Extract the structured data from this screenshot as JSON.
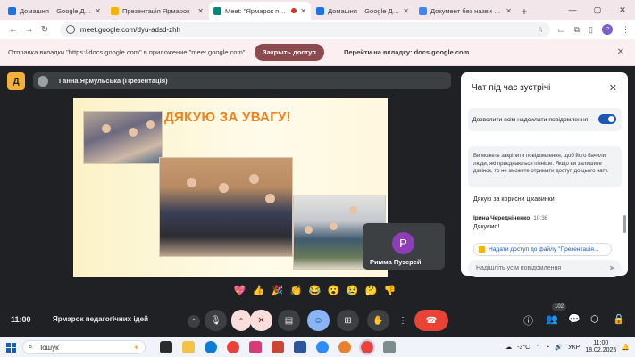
{
  "tabs": [
    {
      "title": "Домашня – Google Диск",
      "favicon_color": "#1a73e8",
      "active": false
    },
    {
      "title": "Презентація Ярмарок",
      "favicon_color": "#f4b400",
      "active": false
    },
    {
      "title": "Meet: \"Ярмарок педаго",
      "favicon_color": "#00897b",
      "active": true
    },
    {
      "title": "Домашня – Google Диск",
      "favicon_color": "#1a73e8",
      "active": false
    },
    {
      "title": "Документ без назви - Goo",
      "favicon_color": "#4285f4",
      "active": false
    }
  ],
  "tabstrip": {
    "new_tab": "+",
    "close": "✕"
  },
  "window": {
    "minimize": "—",
    "maximize": "▢",
    "close": "✕"
  },
  "address": {
    "url": "meet.google.com/dyu-adsd-zhh"
  },
  "infobar": {
    "message": "Отправка вкладки \"https://docs.google.com\" в приложение \"meet.google.com\"...",
    "share_button": "Закрыть доступ",
    "goto_link": "Перейти на вкладку: docs.google.com",
    "close": "✕"
  },
  "meet": {
    "logo_letter": "Д",
    "presenter": "Ганна Ярмульська (Презентація)",
    "slide_title": "ДЯКУЮ ЗА УВАГУ!",
    "participant": {
      "initial": "P",
      "name": "Римма Пузерей"
    },
    "clock": "11:00",
    "meeting_name": "Ярмарок педагогічних ідей",
    "people_count": "102"
  },
  "chat": {
    "title": "Чат під час зустрічі",
    "close": "✕",
    "allow_label": "Дозволити всім надсилати повідомлення",
    "allow_enabled": true,
    "note": "Ви можете закріпити повідомлення, щоб його бачили люди, які приєднаються пізніше. Якщо ви залишите дзвінок, то не зможете отримати доступ до цього чату.",
    "messages": [
      {
        "sender": "",
        "time": "",
        "text": "Дякую за корисни цікавинки"
      },
      {
        "sender": "Ірина Чередніченко",
        "time": "10:36",
        "text": "Дякуємо!"
      }
    ],
    "file_access": "Надати доступ до файлу \"Презентація...",
    "input_placeholder": "Надішліть усім повідомлення"
  },
  "reactions": [
    "💖",
    "👍",
    "🎉",
    "👏",
    "😂",
    "😮",
    "😢",
    "🤔",
    "👎"
  ],
  "taskbar": {
    "search_placeholder": "Пошук",
    "weather": "-3°C",
    "lang": "УКР",
    "time": "11:00",
    "date": "18.02.2025"
  },
  "colors": {
    "meet_bg": "#202124",
    "accent_blue": "#8ab4f8",
    "hangup_red": "#ea4335",
    "slide_title_orange": "#f27f1b"
  }
}
